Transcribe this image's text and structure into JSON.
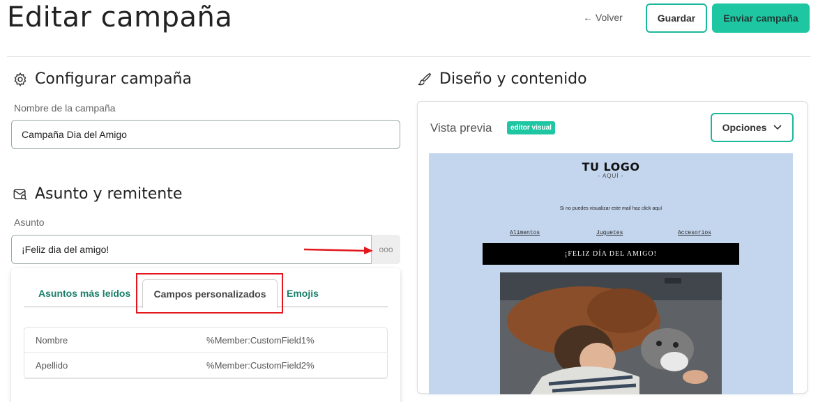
{
  "header": {
    "title": "Editar campaña",
    "back_label": "← Volver",
    "save_label": "Guardar",
    "send_label": "Enviar campaña"
  },
  "config": {
    "section_title": "Configurar campaña",
    "name_label": "Nombre de la campaña",
    "name_value": "Campaña Dia del Amigo"
  },
  "subject": {
    "section_title": "Asunto y remitente",
    "label": "Asunto",
    "value": "¡Feliz dia del amigo!",
    "more_glyph": "ooo",
    "tabs": [
      "Asuntos más leídos",
      "Campos personalizados",
      "Emojis"
    ],
    "active_tab": "Campos personalizados",
    "fields": [
      {
        "name": "Nombre",
        "tag": "%Member:CustomField1%"
      },
      {
        "name": "Apellido",
        "tag": "%Member:CustomField2%"
      }
    ]
  },
  "design": {
    "section_title": "Diseño y contenido",
    "preview_label": "Vista previa",
    "badge": "editor visual",
    "options_label": "Opciones",
    "email": {
      "logo": "TU LOGO",
      "logo_sub": "- AQUÍ -",
      "notice": "Si no puedes visualizar este mail haz click aquí",
      "nav": [
        "Alimentos",
        "Juguetes",
        "Accesorios"
      ],
      "banner": "¡FELIZ DÍA DEL AMIGO!"
    }
  },
  "colors": {
    "accent": "#1ec6a2",
    "highlight": "#e3171d",
    "email_bg": "#c4d6ee"
  }
}
